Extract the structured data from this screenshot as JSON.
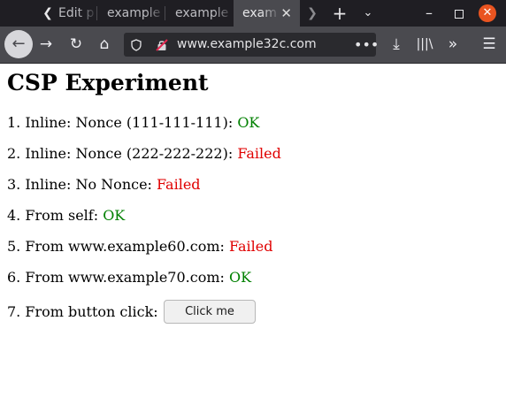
{
  "browser": {
    "tabs": [
      {
        "label": "Edit p",
        "active": false
      },
      {
        "label": "example",
        "active": false
      },
      {
        "label": "example",
        "active": false
      },
      {
        "label": "exam",
        "active": true
      }
    ],
    "url": "www.example32c.com",
    "icons": {
      "tab_back": "chevron-left-icon",
      "tab_forward": "chevron-right-icon",
      "new_tab": "plus-icon",
      "tab_list": "chevron-down-icon",
      "minimize": "minimize-icon",
      "maximize": "maximize-icon",
      "window_close": "close-icon",
      "back": "arrow-left-icon",
      "forward": "arrow-right-icon",
      "reload": "reload-icon",
      "home": "home-icon",
      "shield": "shield-icon",
      "insecure": "insecure-lock-icon",
      "page_actions": "more-dots-icon",
      "downloads": "download-icon",
      "library": "library-icon",
      "overflow": "double-chevron-icon",
      "menu": "hamburger-menu-icon"
    }
  },
  "page": {
    "title": "CSP Experiment",
    "items": [
      {
        "text": "1. Inline: Nonce (111-111-111): ",
        "status": "OK",
        "ok": true
      },
      {
        "text": "2. Inline: Nonce (222-222-222): ",
        "status": "Failed",
        "ok": false
      },
      {
        "text": "3. Inline: No Nonce: ",
        "status": "Failed",
        "ok": false
      },
      {
        "text": "4. From self: ",
        "status": "OK",
        "ok": true
      },
      {
        "text": "5. From www.example60.com: ",
        "status": "Failed",
        "ok": false
      },
      {
        "text": "6. From www.example70.com: ",
        "status": "OK",
        "ok": true
      }
    ],
    "button_row_text": "7. From button click: ",
    "button_label": "Click me",
    "colors": {
      "ok": "#008000",
      "failed": "#e00000"
    }
  }
}
